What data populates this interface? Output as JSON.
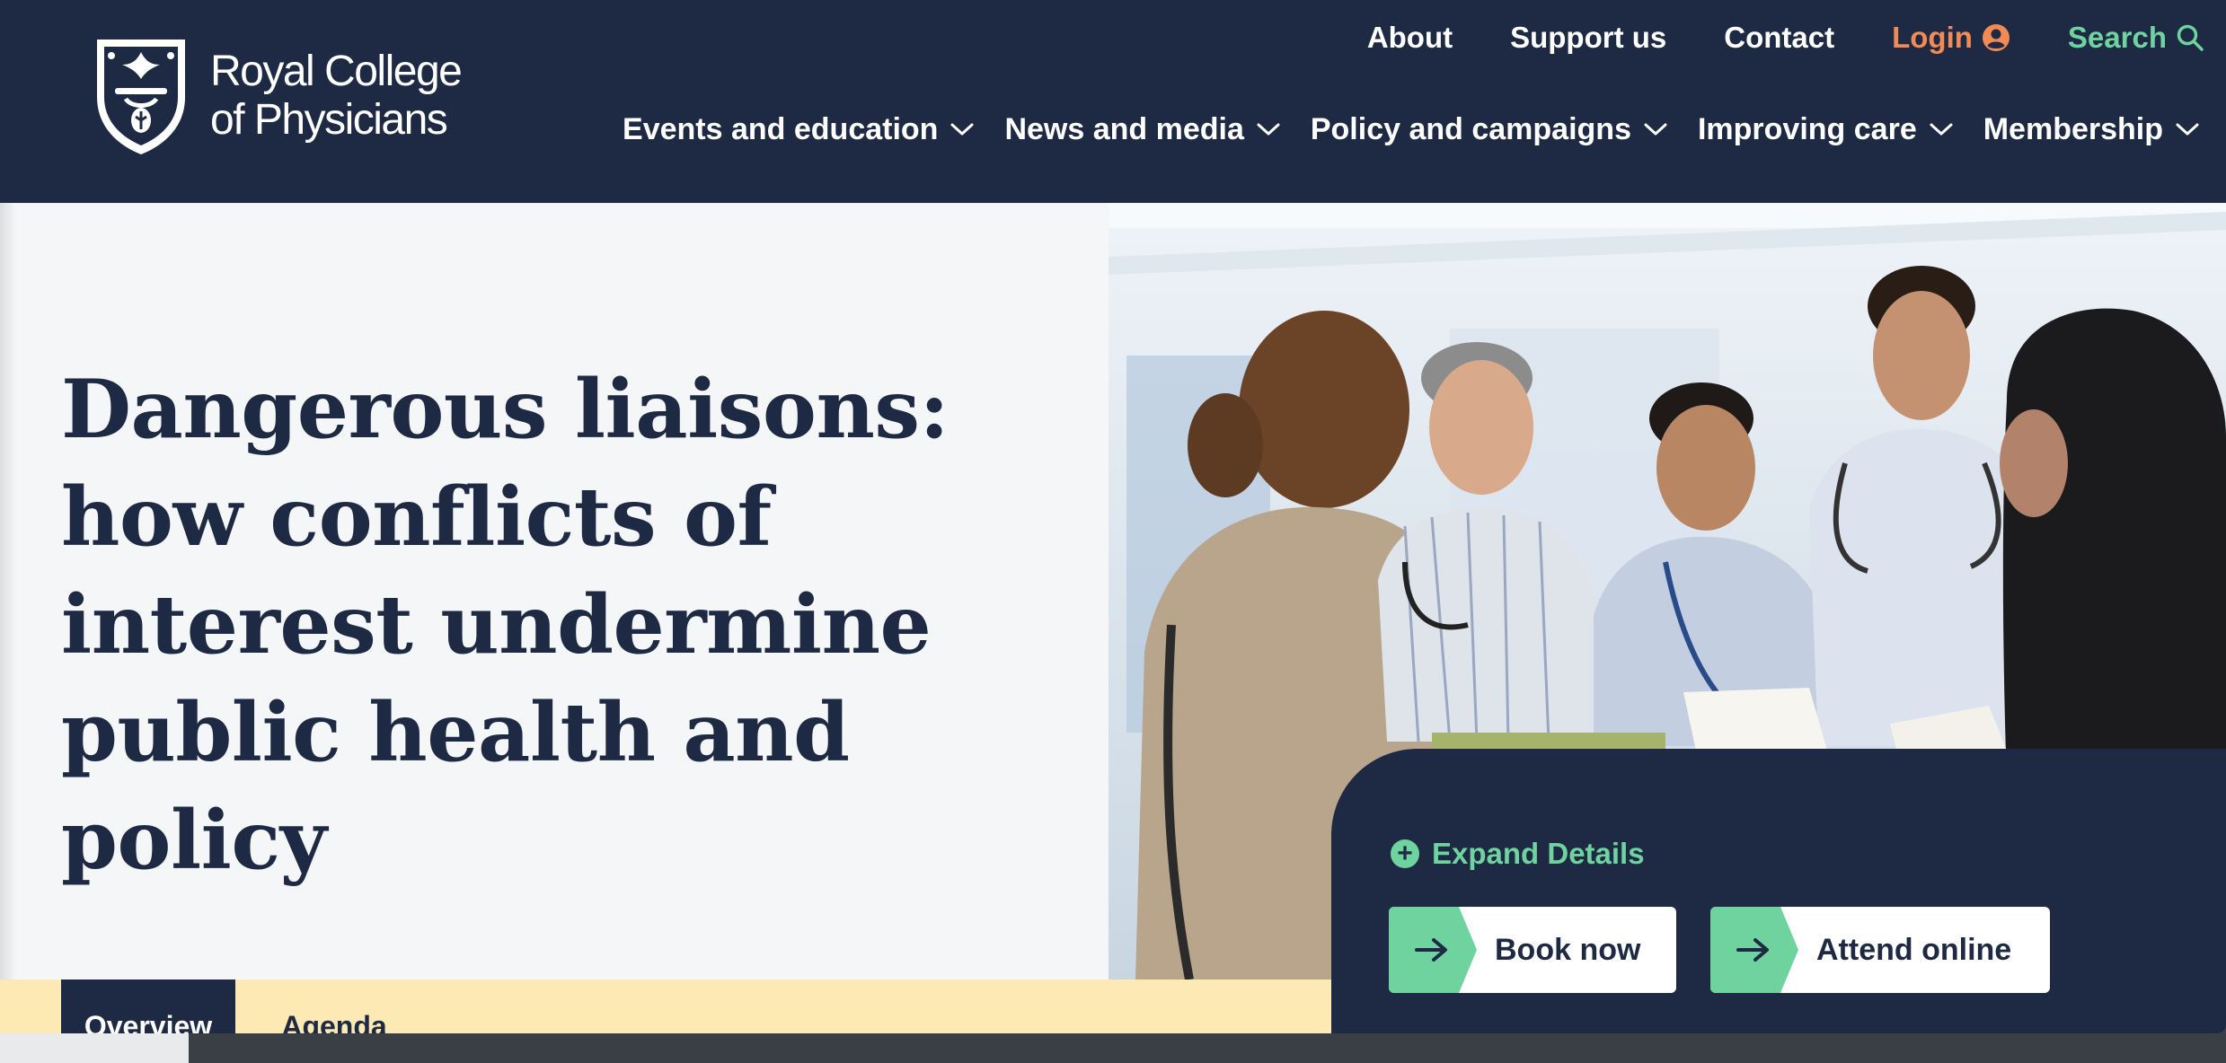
{
  "header": {
    "logo_text_line1": "Royal College",
    "logo_text_line2": "of Physicians",
    "utility_nav": {
      "about": "About",
      "support": "Support us",
      "contact": "Contact",
      "login": "Login",
      "search": "Search"
    },
    "main_nav": [
      {
        "label": "Events and education"
      },
      {
        "label": "News and media"
      },
      {
        "label": "Policy and campaigns"
      },
      {
        "label": "Improving care"
      },
      {
        "label": "Membership"
      }
    ]
  },
  "hero": {
    "title": "Dangerous liaisons: how conflicts of interest undermine public health and policy",
    "expand_details": "Expand Details",
    "book_now": "Book now",
    "attend_online": "Attend online"
  },
  "tabs": {
    "overview": "Overview",
    "agenda": "Agenda"
  },
  "colors": {
    "navy": "#1e2a44",
    "accent_green": "#6fd3a0",
    "login_orange": "#f28a55",
    "tab_bar_yellow": "#fde9b4",
    "hero_bg": "#f4f6f8"
  },
  "icons": {
    "login": "user-circle-icon",
    "search": "magnifier-icon",
    "dropdown": "chevron-down-icon",
    "expand": "plus-circle-icon",
    "cta": "arrow-right-icon"
  }
}
